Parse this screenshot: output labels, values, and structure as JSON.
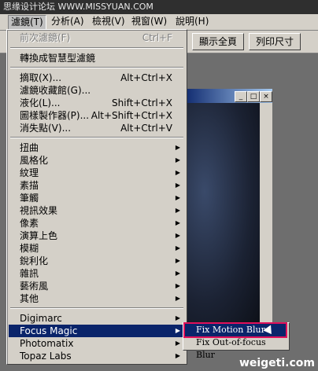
{
  "watermark_top": "思缘设计论坛 WWW.MISSYUAN.COM",
  "menubar": [
    {
      "label": "濾鏡(T)"
    },
    {
      "label": "分析(A)"
    },
    {
      "label": "檢視(V)"
    },
    {
      "label": "視窗(W)"
    },
    {
      "label": "說明(H)"
    }
  ],
  "toolbar": {
    "fit_screen": "顯示全頁",
    "print_size": "列印尺寸"
  },
  "menu": {
    "last_filter": {
      "label": "前次濾鏡(F)",
      "shortcut": "Ctrl+F"
    },
    "convert_smart": {
      "label": "轉換成智慧型濾鏡"
    },
    "extract": {
      "label": "摘取(X)...",
      "shortcut": "Alt+Ctrl+X"
    },
    "filter_gallery": {
      "label": "濾鏡收藏館(G)..."
    },
    "liquify": {
      "label": "液化(L)...",
      "shortcut": "Shift+Ctrl+X"
    },
    "pattern_maker": {
      "label": "圖樣製作器(P)...",
      "shortcut": "Alt+Shift+Ctrl+X"
    },
    "vanishing_point": {
      "label": "消失點(V)...",
      "shortcut": "Alt+Ctrl+V"
    },
    "groups": [
      "扭曲",
      "風格化",
      "紋理",
      "素描",
      "筆觸",
      "視訊效果",
      "像素",
      "演算上色",
      "模糊",
      "銳利化",
      "雜訊",
      "藝術風",
      "其他"
    ],
    "plugins": [
      "Digimarc",
      "Focus Magic",
      "Photomatix",
      "Topaz Labs"
    ]
  },
  "submenu": [
    "Fix Motion Blur",
    "Fix Out-of-focus Blur"
  ],
  "watermark_bottom": "weigeti.com"
}
